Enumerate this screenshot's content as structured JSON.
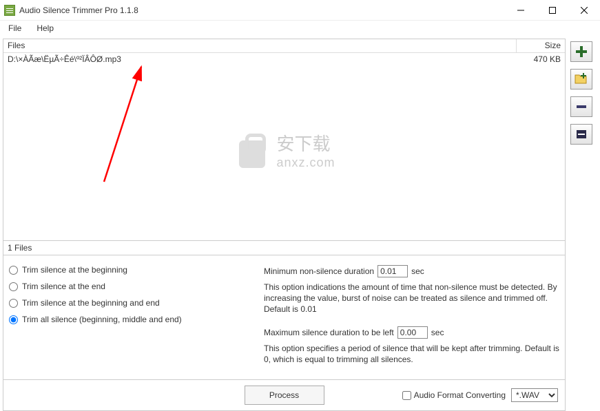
{
  "app": {
    "title": "Audio Silence Trimmer Pro 1.1.8"
  },
  "menu": {
    "file": "File",
    "help": "Help"
  },
  "fileList": {
    "header": {
      "files": "Files",
      "size": "Size"
    },
    "rows": [
      {
        "path": "D:\\×ÀÃæ\\ËµÃ÷Êé\\º²ÏÂÔØ.mp3",
        "size": "470 KB"
      }
    ],
    "count": "1 Files"
  },
  "watermark": {
    "line1": "安下载",
    "line2": "anxz.com"
  },
  "radios": {
    "r1": "Trim silence at the beginning",
    "r2": "Trim silence at the end",
    "r3": "Trim silence at the beginning and end",
    "r4": "Trim all silence (beginning, middle and end)"
  },
  "opts": {
    "minLabel": "Minimum non-silence duration",
    "minVal": "0.01",
    "sec": "sec",
    "minDesc": "This option indications the amount of time that non-silence must be detected. By increasing the value, burst of noise can be treated as silence and trimmed off. Default is 0.01",
    "maxLabel": "Maximum silence duration to be left",
    "maxVal": "0.00",
    "maxDesc": "This option specifies a period of silence that will be kept after trimming. Default is 0, which is equal to trimming all silences."
  },
  "bottom": {
    "process": "Process",
    "convert": "Audio Format Converting",
    "format": "*.WAV"
  },
  "tools": {
    "add": "add-file",
    "addFolder": "add-folder",
    "remove": "remove-file",
    "removeAll": "remove-all"
  }
}
